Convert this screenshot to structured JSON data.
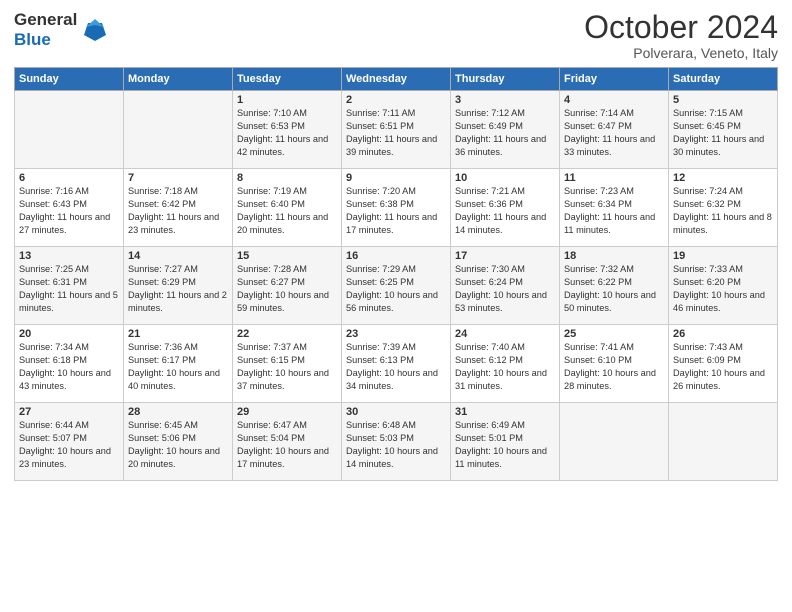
{
  "header": {
    "logo_line1": "General",
    "logo_line2": "Blue",
    "title": "October 2024",
    "subtitle": "Polverara, Veneto, Italy"
  },
  "days_of_week": [
    "Sunday",
    "Monday",
    "Tuesday",
    "Wednesday",
    "Thursday",
    "Friday",
    "Saturday"
  ],
  "weeks": [
    [
      {
        "day": "",
        "info": ""
      },
      {
        "day": "",
        "info": ""
      },
      {
        "day": "1",
        "info": "Sunrise: 7:10 AM\nSunset: 6:53 PM\nDaylight: 11 hours and 42 minutes."
      },
      {
        "day": "2",
        "info": "Sunrise: 7:11 AM\nSunset: 6:51 PM\nDaylight: 11 hours and 39 minutes."
      },
      {
        "day": "3",
        "info": "Sunrise: 7:12 AM\nSunset: 6:49 PM\nDaylight: 11 hours and 36 minutes."
      },
      {
        "day": "4",
        "info": "Sunrise: 7:14 AM\nSunset: 6:47 PM\nDaylight: 11 hours and 33 minutes."
      },
      {
        "day": "5",
        "info": "Sunrise: 7:15 AM\nSunset: 6:45 PM\nDaylight: 11 hours and 30 minutes."
      }
    ],
    [
      {
        "day": "6",
        "info": "Sunrise: 7:16 AM\nSunset: 6:43 PM\nDaylight: 11 hours and 27 minutes."
      },
      {
        "day": "7",
        "info": "Sunrise: 7:18 AM\nSunset: 6:42 PM\nDaylight: 11 hours and 23 minutes."
      },
      {
        "day": "8",
        "info": "Sunrise: 7:19 AM\nSunset: 6:40 PM\nDaylight: 11 hours and 20 minutes."
      },
      {
        "day": "9",
        "info": "Sunrise: 7:20 AM\nSunset: 6:38 PM\nDaylight: 11 hours and 17 minutes."
      },
      {
        "day": "10",
        "info": "Sunrise: 7:21 AM\nSunset: 6:36 PM\nDaylight: 11 hours and 14 minutes."
      },
      {
        "day": "11",
        "info": "Sunrise: 7:23 AM\nSunset: 6:34 PM\nDaylight: 11 hours and 11 minutes."
      },
      {
        "day": "12",
        "info": "Sunrise: 7:24 AM\nSunset: 6:32 PM\nDaylight: 11 hours and 8 minutes."
      }
    ],
    [
      {
        "day": "13",
        "info": "Sunrise: 7:25 AM\nSunset: 6:31 PM\nDaylight: 11 hours and 5 minutes."
      },
      {
        "day": "14",
        "info": "Sunrise: 7:27 AM\nSunset: 6:29 PM\nDaylight: 11 hours and 2 minutes."
      },
      {
        "day": "15",
        "info": "Sunrise: 7:28 AM\nSunset: 6:27 PM\nDaylight: 10 hours and 59 minutes."
      },
      {
        "day": "16",
        "info": "Sunrise: 7:29 AM\nSunset: 6:25 PM\nDaylight: 10 hours and 56 minutes."
      },
      {
        "day": "17",
        "info": "Sunrise: 7:30 AM\nSunset: 6:24 PM\nDaylight: 10 hours and 53 minutes."
      },
      {
        "day": "18",
        "info": "Sunrise: 7:32 AM\nSunset: 6:22 PM\nDaylight: 10 hours and 50 minutes."
      },
      {
        "day": "19",
        "info": "Sunrise: 7:33 AM\nSunset: 6:20 PM\nDaylight: 10 hours and 46 minutes."
      }
    ],
    [
      {
        "day": "20",
        "info": "Sunrise: 7:34 AM\nSunset: 6:18 PM\nDaylight: 10 hours and 43 minutes."
      },
      {
        "day": "21",
        "info": "Sunrise: 7:36 AM\nSunset: 6:17 PM\nDaylight: 10 hours and 40 minutes."
      },
      {
        "day": "22",
        "info": "Sunrise: 7:37 AM\nSunset: 6:15 PM\nDaylight: 10 hours and 37 minutes."
      },
      {
        "day": "23",
        "info": "Sunrise: 7:39 AM\nSunset: 6:13 PM\nDaylight: 10 hours and 34 minutes."
      },
      {
        "day": "24",
        "info": "Sunrise: 7:40 AM\nSunset: 6:12 PM\nDaylight: 10 hours and 31 minutes."
      },
      {
        "day": "25",
        "info": "Sunrise: 7:41 AM\nSunset: 6:10 PM\nDaylight: 10 hours and 28 minutes."
      },
      {
        "day": "26",
        "info": "Sunrise: 7:43 AM\nSunset: 6:09 PM\nDaylight: 10 hours and 26 minutes."
      }
    ],
    [
      {
        "day": "27",
        "info": "Sunrise: 6:44 AM\nSunset: 5:07 PM\nDaylight: 10 hours and 23 minutes."
      },
      {
        "day": "28",
        "info": "Sunrise: 6:45 AM\nSunset: 5:06 PM\nDaylight: 10 hours and 20 minutes."
      },
      {
        "day": "29",
        "info": "Sunrise: 6:47 AM\nSunset: 5:04 PM\nDaylight: 10 hours and 17 minutes."
      },
      {
        "day": "30",
        "info": "Sunrise: 6:48 AM\nSunset: 5:03 PM\nDaylight: 10 hours and 14 minutes."
      },
      {
        "day": "31",
        "info": "Sunrise: 6:49 AM\nSunset: 5:01 PM\nDaylight: 10 hours and 11 minutes."
      },
      {
        "day": "",
        "info": ""
      },
      {
        "day": "",
        "info": ""
      }
    ]
  ]
}
